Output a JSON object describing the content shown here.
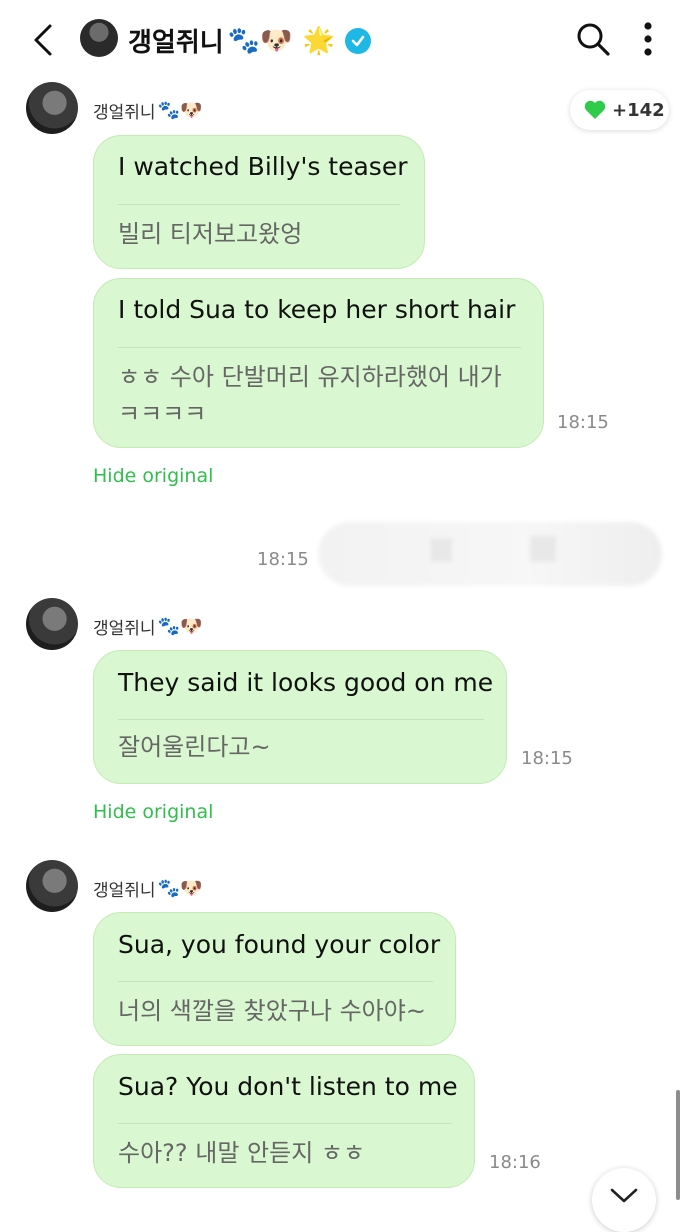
{
  "header": {
    "name": "갱얼쥐니",
    "emojis": "🐾🐶",
    "star": "🌟",
    "icons": [
      "back-icon",
      "search-icon",
      "more-icon",
      "verified-icon"
    ]
  },
  "reaction": {
    "count": "+142",
    "color": "#2ecc4a"
  },
  "messages": [
    {
      "sender": "갱얼쥐니",
      "sender_emoji": "🐾🐶",
      "bubbles": [
        {
          "text": "I watched Billy's teaser",
          "original": [
            "빌리 티저보고왔엉"
          ]
        },
        {
          "text": "I told Sua to keep her short hair",
          "original": [
            "ㅎㅎ 수아 단발머리 유지하라했어 내가",
            "ㅋㅋㅋㅋ"
          ],
          "time": "18:15"
        }
      ],
      "hide_label": "Hide original"
    },
    {
      "mine_time": "18:15"
    },
    {
      "sender": "갱얼쥐니",
      "sender_emoji": "🐾🐶",
      "bubbles": [
        {
          "text": "They said it looks good on me",
          "original": [
            "잘어울린다고~"
          ],
          "time": "18:15"
        }
      ],
      "hide_label": "Hide original"
    },
    {
      "sender": "갱얼쥐니",
      "sender_emoji": "🐾🐶",
      "bubbles": [
        {
          "text": "Sua, you found your color",
          "original": [
            "너의 색깔을 찾았구나 수아야~"
          ]
        },
        {
          "text": "Sua? You don't listen to me",
          "original": [
            "수아?? 내말 안듣지 ㅎㅎ"
          ],
          "time": "18:16"
        }
      ]
    }
  ],
  "colors": {
    "bubble": "#d9f7d0",
    "link": "#2fbf4c",
    "verified": "#1fb8e6"
  }
}
